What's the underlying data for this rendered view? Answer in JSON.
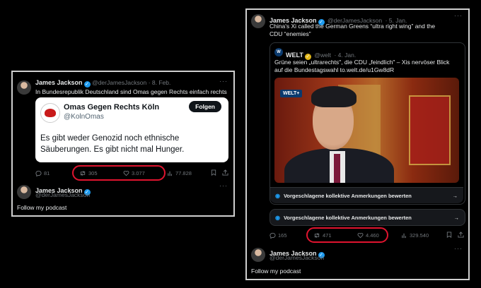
{
  "left": {
    "tweet": {
      "name": "James Jackson",
      "handle": "@derJamesJackson",
      "date": "· 8. Feb.",
      "text": "In Bundesrepublik Deutschland sind Omas gegen Rechts einfach rechts",
      "quote": {
        "logo_text": "OMAS GEGEN RECHTS",
        "name": "Omas Gegen Rechts Köln",
        "handle": "@KolnOmas",
        "follow_label": "Folgen",
        "text": "Es gibt weder Genozid noch ethnische Säuberungen. Es gibt nicht mal Hunger."
      },
      "stats": {
        "replies": "81",
        "reposts": "305",
        "likes": "3.077",
        "views": "77.828"
      }
    },
    "reply": {
      "name": "James Jackson",
      "handle": "@derJamesJackson",
      "text": "Follow my podcast"
    }
  },
  "right": {
    "tweet": {
      "name": "James Jackson",
      "handle": "@derJamesJackson",
      "date": "· 5. Jan.",
      "text": "China's Xi called the German Greens “ultra right wing” and the CDU “enemies”",
      "quote": {
        "name": "WELT",
        "handle": "@welt",
        "date": "· 4. Jan.",
        "text": "Grüne seien „ultrarechts\", die CDU „feindlich\" – Xis nervöser Blick auf die Bundestagswahl to.welt.de/u1Gw8dR",
        "image_badge": "WELT+",
        "note_label": "Vorgeschlagene kollektive Anmerkungen bewerten"
      },
      "note_label": "Vorgeschlagene kollektive Anmerkungen bewerten",
      "stats": {
        "replies": "165",
        "reposts": "471",
        "likes": "4.460",
        "views": "329.540"
      }
    },
    "reply": {
      "name": "James Jackson",
      "handle": "@derJamesJackson",
      "text": "Follow my podcast"
    }
  },
  "colors": {
    "background": "#000000",
    "accent": "#1d9bf0",
    "highlight": "#e0142f",
    "frame": "#cfcfcf"
  }
}
